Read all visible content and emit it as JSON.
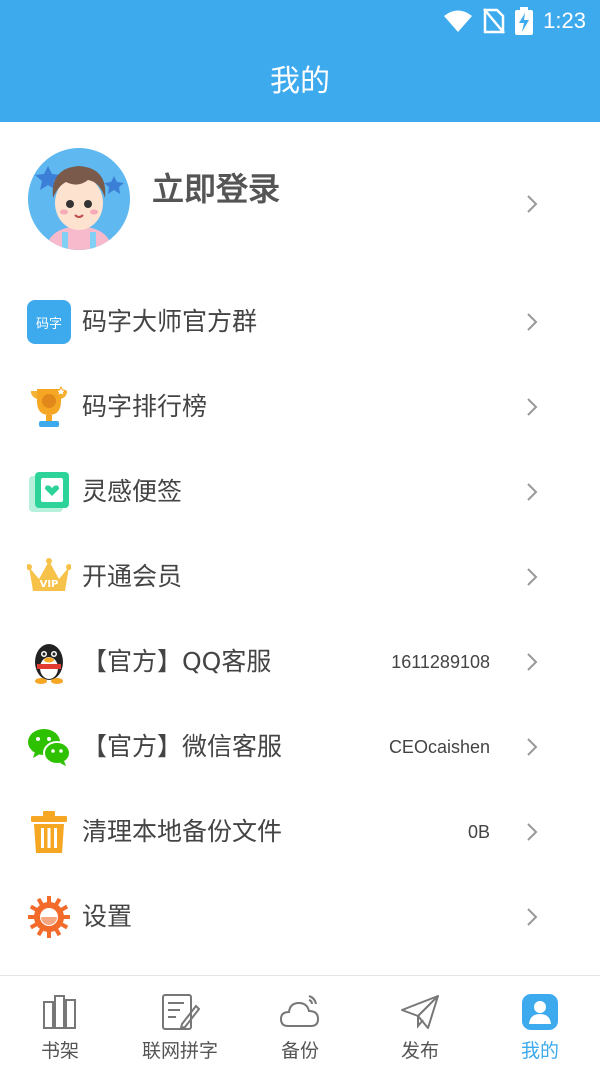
{
  "status_bar": {
    "time": "1:23"
  },
  "header": {
    "title": "我的"
  },
  "profile": {
    "login_label": "立即登录"
  },
  "menu": [
    {
      "label": "码字大师官方群",
      "value": "",
      "icon": "qq-group-icon"
    },
    {
      "label": "码字排行榜",
      "value": "",
      "icon": "trophy-icon"
    },
    {
      "label": "灵感便签",
      "value": "",
      "icon": "note-icon"
    },
    {
      "label": "开通会员",
      "value": "",
      "icon": "vip-crown-icon"
    },
    {
      "label": "【官方】QQ客服",
      "value": "1611289108",
      "icon": "qq-penguin-icon"
    },
    {
      "label": "【官方】微信客服",
      "value": "CEOcaishen",
      "icon": "wechat-icon"
    },
    {
      "label": "清理本地备份文件",
      "value": "0B",
      "icon": "trash-icon"
    },
    {
      "label": "设置",
      "value": "",
      "icon": "settings-gear-icon"
    }
  ],
  "icon_texts": {
    "group_logo": "码字",
    "vip_badge": "VIP"
  },
  "tabs": [
    {
      "label": "书架",
      "active": false
    },
    {
      "label": "联网拼字",
      "active": false
    },
    {
      "label": "备份",
      "active": false
    },
    {
      "label": "发布",
      "active": false
    },
    {
      "label": "我的",
      "active": true
    }
  ],
  "colors": {
    "primary": "#3daaee",
    "text": "#444444",
    "chevron": "#999999"
  }
}
